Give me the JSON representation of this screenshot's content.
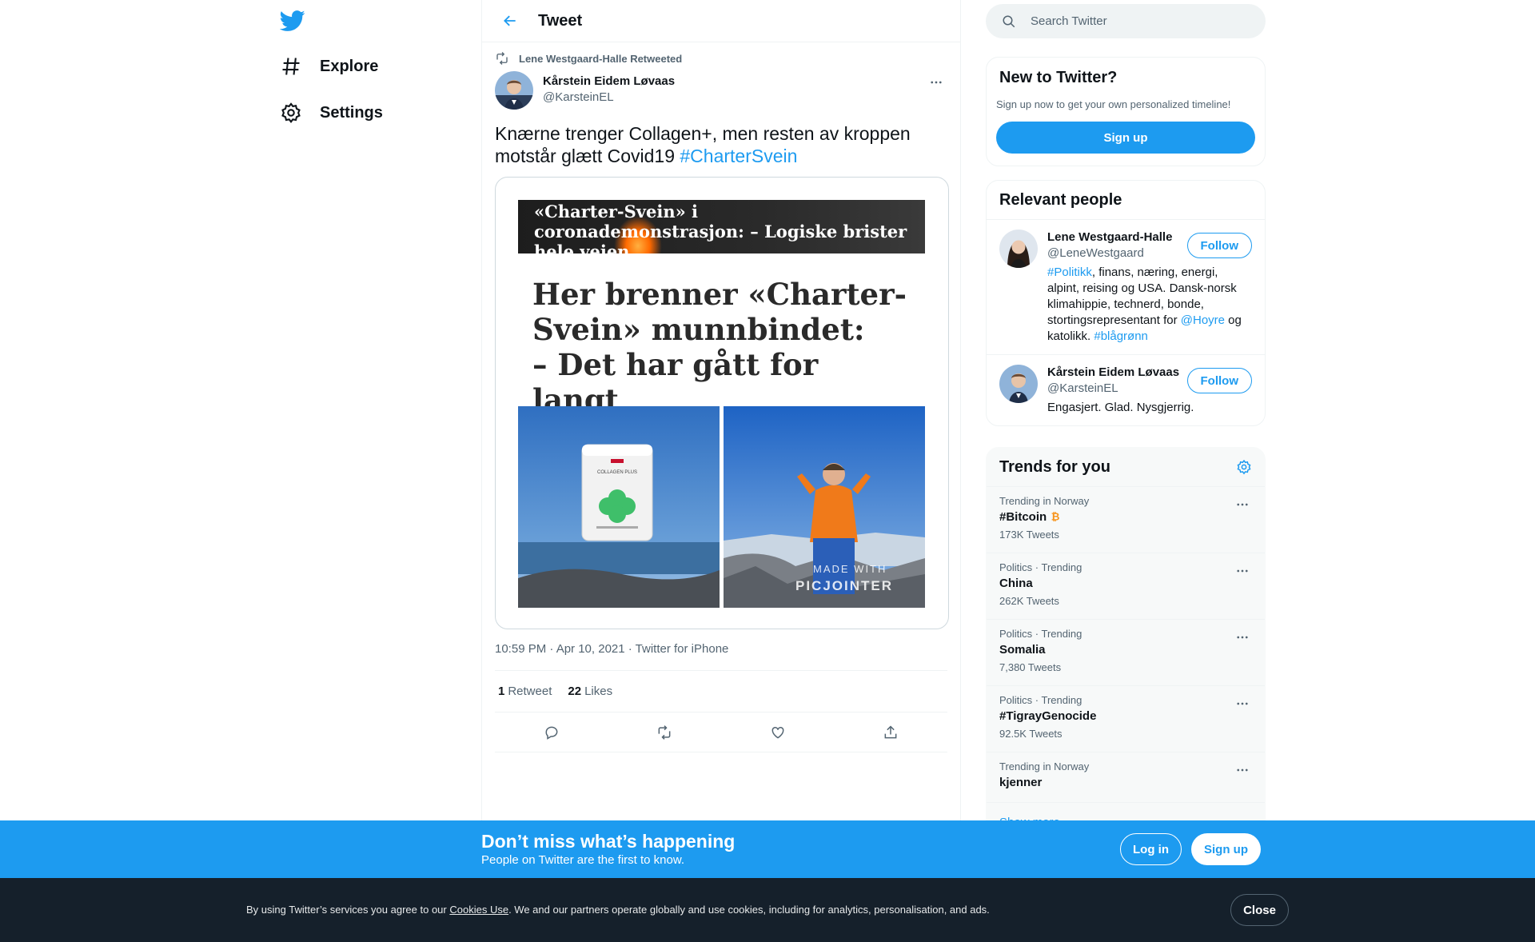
{
  "nav": {
    "items": [
      {
        "label": "Explore",
        "icon": "hashtag-icon"
      },
      {
        "label": "Settings",
        "icon": "gear-icon"
      }
    ]
  },
  "header": {
    "title": "Tweet"
  },
  "tweet": {
    "retweeted_by": "Lene Westgaard-Halle Retweeted",
    "author_name": "Kårstein Eidem Løvaas",
    "author_handle": "@KarsteinEL",
    "text_plain": "Knærne trenger Collagen+, men resten av kroppen motstår glætt Covid19",
    "hashtag": "#CharterSvein",
    "media": {
      "top_headline": "«Charter-Svein» i coronademonstrasjon: – Logiske brister hele veien",
      "main_headline_1": "Her brenner «Charter-",
      "main_headline_2": "Svein» munnbindet:",
      "main_headline_3": "– Det har gått for langt",
      "product_label": "COLLAGEN PLUS",
      "watermark_1": "MADE WITH",
      "watermark_2": "PICJOINTER"
    },
    "timestamp": "10:59 PM · Apr 10, 2021 · Twitter for iPhone",
    "retweets_count": "1",
    "retweets_label": "Retweet",
    "likes_count": "22",
    "likes_label": "Likes"
  },
  "search": {
    "placeholder": "Search Twitter"
  },
  "new_to_twitter": {
    "title": "New to Twitter?",
    "subtitle": "Sign up now to get your own personalized timeline!",
    "button": "Sign up"
  },
  "relevant_people": {
    "title": "Relevant people",
    "people": [
      {
        "name": "Lene Westgaard-Halle",
        "handle": "@LeneWestgaard",
        "bio_link1": "#Politikk",
        "bio_text1": ", finans, næring, energi, alpint, reising og USA. Dansk-norsk klimahippie, technerd, bonde, stortingsrepresentant for ",
        "bio_link2": "@Hoyre",
        "bio_text2": " og katolikk. ",
        "bio_link3": "#blågrønn",
        "follow": "Follow"
      },
      {
        "name": "Kårstein Eidem Løvaas",
        "handle": "@KarsteinEL",
        "bio": "Engasjert. Glad. Nysgjerrig.",
        "follow": "Follow"
      }
    ]
  },
  "trends": {
    "title": "Trends for you",
    "items": [
      {
        "meta": "Trending in Norway",
        "name": "#Bitcoin",
        "count": "173K Tweets"
      },
      {
        "meta": "Politics · Trending",
        "name": "China",
        "count": "262K Tweets"
      },
      {
        "meta": "Politics · Trending",
        "name": "Somalia",
        "count": "7,380 Tweets"
      },
      {
        "meta": "Politics · Trending",
        "name": "#TigrayGenocide",
        "count": "92.5K Tweets"
      },
      {
        "meta": "Trending in Norway",
        "name": "kjenner",
        "count": ""
      }
    ],
    "show_more": "Show more"
  },
  "banner": {
    "title": "Don’t miss what’s happening",
    "subtitle": "People on Twitter are the first to know.",
    "login": "Log in",
    "signup": "Sign up"
  },
  "cookie": {
    "text_before": "By using Twitter’s services you agree to our ",
    "link": "Cookies Use",
    "text_after": ". We and our partners operate globally and use cookies, including for analytics, personalisation, and ads.",
    "close": "Close"
  },
  "colors": {
    "accent": "#1d9bf0",
    "text": "#0f1419",
    "muted": "#536471",
    "cookie_bg": "#15202b",
    "bitcoin": "#f7931a"
  }
}
